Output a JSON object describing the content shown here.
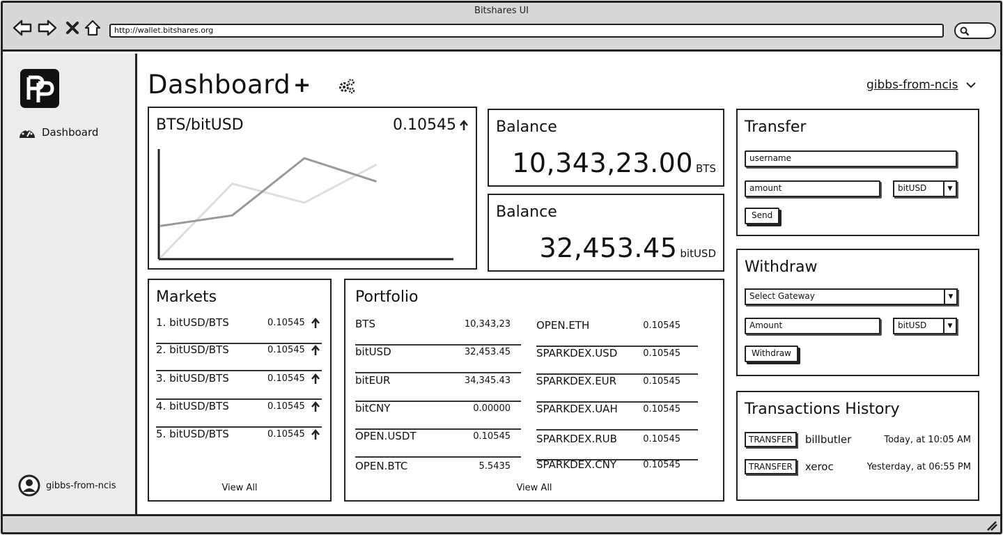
{
  "window": {
    "title": "Bitshares UI"
  },
  "browser": {
    "url": "http://wallet.bitshares.org"
  },
  "sidebar": {
    "items": [
      {
        "label": "Dashboard"
      }
    ],
    "user": "gibbs-from-ncis"
  },
  "header": {
    "title": "Dashboard",
    "user_menu": "gibbs-from-ncis"
  },
  "chart": {
    "pair": "BTS/bitUSD",
    "price": "0.10545"
  },
  "chart_data": {
    "type": "line",
    "title": "BTS/bitUSD",
    "x": [
      0,
      1,
      2,
      3,
      4
    ],
    "series": [
      {
        "values": [
          0.0,
          3.5,
          2.6,
          4.4,
          null
        ],
        "color": "#dddddd"
      },
      {
        "values": [
          1.5,
          2.0,
          4.7,
          3.6,
          null
        ],
        "color": "#999999"
      }
    ],
    "ylim": [
      0,
      5
    ],
    "grid": false
  },
  "balances": [
    {
      "label": "Balance",
      "amount": "10,343,23.00",
      "unit": "BTS"
    },
    {
      "label": "Balance",
      "amount": "32,453.45",
      "unit": "bitUSD"
    }
  ],
  "transfer": {
    "title": "Transfer",
    "username_placeholder": "username",
    "amount_placeholder": "amount",
    "currency": "bitUSD",
    "send_label": "Send"
  },
  "withdraw": {
    "title": "Withdraw",
    "gateway_placeholder": "Select Gateway",
    "amount_placeholder": "Amount",
    "currency": "bitUSD",
    "withdraw_label": "Withdraw"
  },
  "history": {
    "title": "Transactions History",
    "rows": [
      {
        "type": "TRANSFER",
        "user": "billbutler",
        "time": "Today, at 10:05 AM"
      },
      {
        "type": "TRANSFER",
        "user": "xeroc",
        "time": "Yesterday, at 06:55 PM"
      }
    ]
  },
  "markets": {
    "title": "Markets",
    "rows": [
      {
        "name": "1. bitUSD/BTS",
        "value": "0.10545"
      },
      {
        "name": "2. bitUSD/BTS",
        "value": "0.10545"
      },
      {
        "name": "3. bitUSD/BTS",
        "value": "0.10545"
      },
      {
        "name": "4. bitUSD/BTS",
        "value": "0.10545"
      },
      {
        "name": "5. bitUSD/BTS",
        "value": "0.10545"
      }
    ],
    "view_all": "View All"
  },
  "portfolio": {
    "title": "Portfolio",
    "left": [
      {
        "name": "BTS",
        "value": "10,343,23"
      },
      {
        "name": "bitUSD",
        "value": "32,453.45"
      },
      {
        "name": "bitEUR",
        "value": "34,345.43"
      },
      {
        "name": "bitCNY",
        "value": "0.00000"
      },
      {
        "name": "OPEN.USDT",
        "value": "0.10545"
      },
      {
        "name": "OPEN.BTC",
        "value": "5.5435"
      }
    ],
    "right": [
      {
        "name": "OPEN.ETH",
        "value": "0.10545"
      },
      {
        "name": "SPARKDEX.USD",
        "value": "0.10545"
      },
      {
        "name": "SPARKDEX.EUR",
        "value": "0.10545"
      },
      {
        "name": "SPARKDEX.UAH",
        "value": "0.10545"
      },
      {
        "name": "SPARKDEX.RUB",
        "value": "0.10545"
      },
      {
        "name": "SPARKDEX.CNY",
        "value": "0.10545"
      }
    ],
    "view_all": "View All"
  }
}
